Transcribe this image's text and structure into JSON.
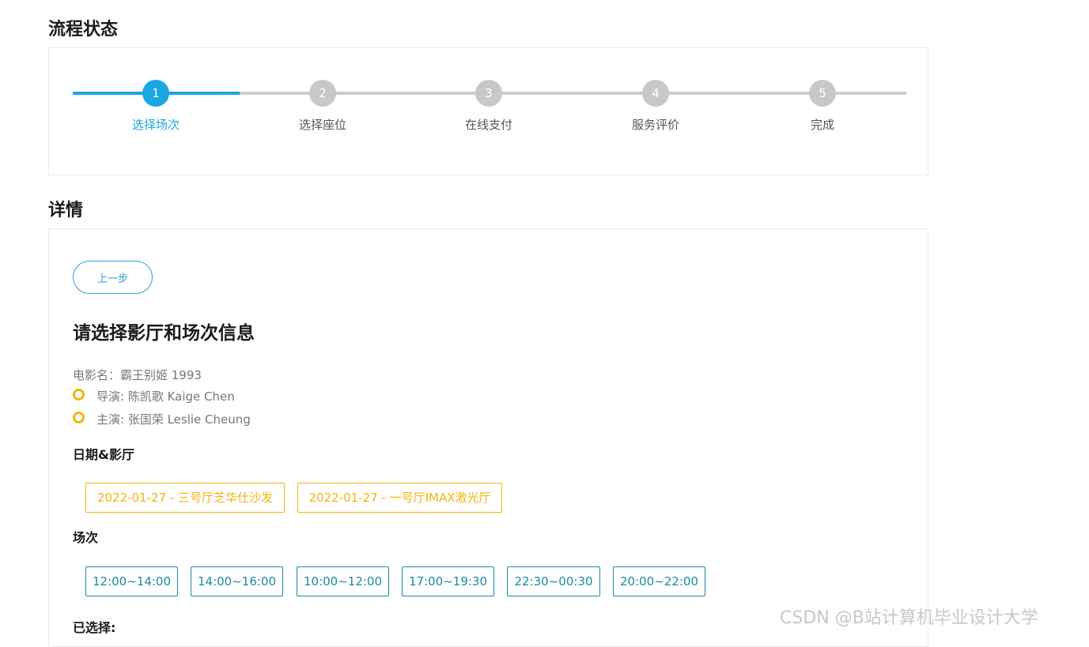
{
  "process": {
    "title": "流程状态",
    "steps": [
      {
        "num": "1",
        "label": "选择场次"
      },
      {
        "num": "2",
        "label": "选择座位"
      },
      {
        "num": "3",
        "label": "在线支付"
      },
      {
        "num": "4",
        "label": "服务评价"
      },
      {
        "num": "5",
        "label": "完成"
      }
    ],
    "active_step": 1
  },
  "details": {
    "title": "详情",
    "prev_button": "上一步",
    "heading": "请选择影厅和场次信息",
    "movie": "电影名：霸王别姬 1993",
    "director": "导演: 陈凯歌 Kaige Chen",
    "actor": "主演: 张国荣 Leslie Cheung",
    "date_hall_label": "日期&影厅",
    "halls": [
      "2022-01-27 - 三号厅芝华仕沙发",
      "2022-01-27 - 一号厅IMAX激光厅"
    ],
    "session_label": "场次",
    "sessions": [
      "12:00~14:00",
      "14:00~16:00",
      "10:00~12:00",
      "17:00~19:30",
      "22:30~00:30",
      "20:00~22:00"
    ],
    "selected_label": "已选择:"
  },
  "colors": {
    "accent": "#1aa7e2",
    "inactive_step": "#c8c8c8",
    "hall_tag": "#f5b312",
    "time_tag": "#1f8a9e",
    "button": "#2e9fdb"
  },
  "watermark": "CSDN @B站计算机毕业设计大学"
}
